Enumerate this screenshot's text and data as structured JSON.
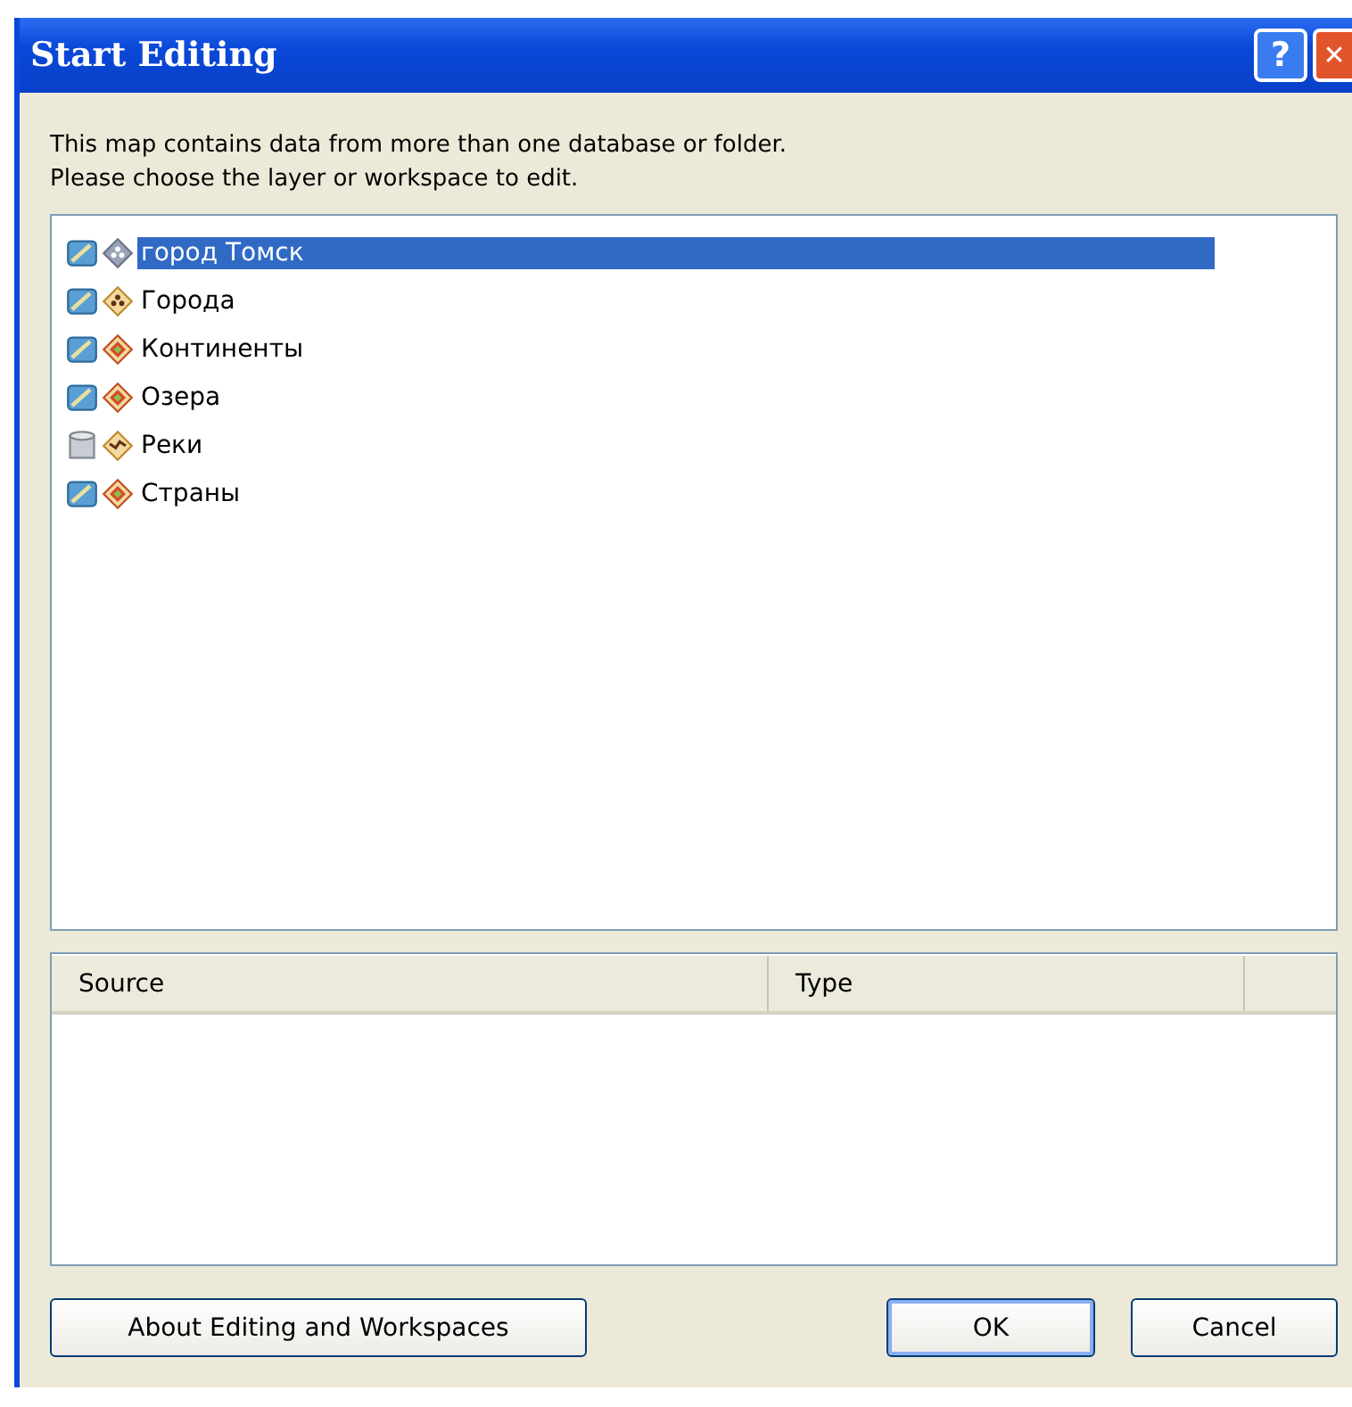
{
  "window": {
    "title": "Start Editing",
    "controls": [
      "?",
      "✕"
    ]
  },
  "message": "This map contains data from more than one database or folder.\nPlease choose the layer or workspace to edit.",
  "layers": [
    {
      "name": "город Томск",
      "selected": true,
      "kind": "greypoints"
    },
    {
      "name": "Города",
      "selected": false,
      "kind": "points"
    },
    {
      "name": "Континенты",
      "selected": false,
      "kind": "polygons"
    },
    {
      "name": "Озера",
      "selected": false,
      "kind": "polygons"
    },
    {
      "name": "Реки",
      "selected": false,
      "kind": "lines"
    },
    {
      "name": "Страны",
      "selected": false,
      "kind": "polygons"
    }
  ],
  "table": {
    "columns": [
      "Source",
      "Type"
    ]
  },
  "buttons": {
    "about": "About Editing and Workspaces",
    "ok": "OK",
    "cancel": "Cancel"
  }
}
